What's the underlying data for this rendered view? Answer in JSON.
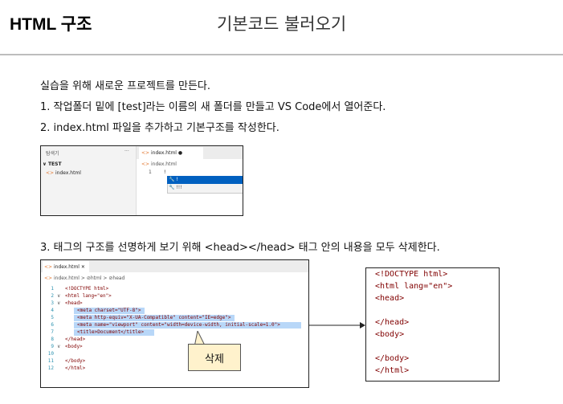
{
  "header": {
    "title": "HTML 구조",
    "subtitle": "기본코드 불러오기"
  },
  "intro": "실습을 위해 새로운 프로젝트를 만든다.",
  "step1": "1. 작업폴더 밑에 [test]라는 이름의 새 폴더를 만들고 VS Code에서 열어준다.",
  "step2": "2. index.html 파일을 추가하고 기본구조를 작성한다.",
  "step3": "3. 태그의 구조를 선명하게 보기 위해 <head></head> 태그 안의 내용을 모두 삭제한다.",
  "explorer_shot": {
    "side_title": "탐색기",
    "side_more": "···",
    "folder": "TEST",
    "file": "index.html",
    "tab_label": "index.html",
    "breadcrumb": "index.html",
    "line_num": "1",
    "typed": "!",
    "suggestions": [
      "!",
      "!!!"
    ]
  },
  "editor_shot": {
    "tab_label": "index.html",
    "breadcrumb": [
      "index.html",
      "html",
      "head"
    ],
    "lines": [
      {
        "n": "1",
        "text": "<!DOCTYPE html>"
      },
      {
        "n": "2",
        "text": "<html lang=\"en\">"
      },
      {
        "n": "3",
        "text": "<head>"
      },
      {
        "n": "4",
        "text": "<meta charset=\"UTF-8\">"
      },
      {
        "n": "5",
        "text": "<meta http-equiv=\"X-UA-Compatible\" content=\"IE=edge\">"
      },
      {
        "n": "6",
        "text": "<meta name=\"viewport\" content=\"width=device-width, initial-scale=1.0\">"
      },
      {
        "n": "7",
        "text": "<title>Document</title>"
      },
      {
        "n": "8",
        "text": "</head>"
      },
      {
        "n": "9",
        "text": "<body>"
      },
      {
        "n": "10",
        "text": ""
      },
      {
        "n": "11",
        "text": "</body>"
      },
      {
        "n": "12",
        "text": "</html>"
      }
    ]
  },
  "callout": "삭제",
  "result_lines": [
    "<!DOCTYPE html>",
    "<html lang=\"en\">",
    "<head>",
    "",
    "</head>",
    "<body>",
    "",
    "</body>",
    "</html>"
  ],
  "colors": {
    "selection": "#b8d7f8",
    "popup_selected": "#0060c0",
    "callout_fill": "#fff2cc",
    "tag": "#800000",
    "attr_value": "#0000ff"
  }
}
